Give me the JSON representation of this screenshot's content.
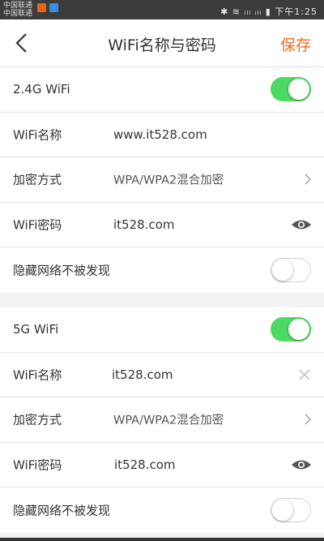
{
  "status_bar": {
    "carrier_1": "中国联通",
    "carrier_2": "中国联通",
    "right_text": "✱ ≋ ᵢₗₗ ᵢₗₗ ▮ 下午1:25"
  },
  "header": {
    "title": "WiFi名称与密码",
    "save_label": "保存",
    "accent_color": "#f06b1f"
  },
  "wifi_24g": {
    "band_label": "2.4G WiFi",
    "enabled": true,
    "name_label": "WiFi名称",
    "name_value": "www.it528.com",
    "encryption_label": "加密方式",
    "encryption_value": "WPA/WPA2混合加密",
    "password_label": "WiFi密码",
    "password_value": "it528.com",
    "hide_label": "隐藏网络不被发现",
    "hidden": false
  },
  "wifi_5g": {
    "band_label": "5G WiFi",
    "enabled": true,
    "name_label": "WiFi名称",
    "name_value": "it528.com",
    "encryption_label": "加密方式",
    "encryption_value": "WPA/WPA2混合加密",
    "password_label": "WiFi密码",
    "password_value": "it528.com",
    "hide_label": "隐藏网络不被发现",
    "hidden": false
  },
  "icons": {
    "back": "chevron-left-icon",
    "next": "chevron-right-icon",
    "show_password": "eye-icon",
    "clear": "close-icon"
  },
  "colors": {
    "toggle_on": "#4cd964",
    "background": "#f2f2f2"
  }
}
